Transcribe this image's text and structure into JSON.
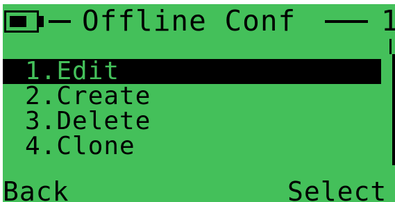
{
  "header": {
    "title": "Offline Conf",
    "corner_text": "1",
    "battery_icon": "battery-icon"
  },
  "menu": {
    "items": [
      {
        "label": "1.Edit",
        "selected": true
      },
      {
        "label": "2.Create",
        "selected": false
      },
      {
        "label": "3.Delete",
        "selected": false
      },
      {
        "label": "4.Clone",
        "selected": false
      }
    ]
  },
  "softkeys": {
    "left": "Back",
    "right": "Select"
  },
  "colors": {
    "screen_background": "#44c05a",
    "foreground": "#000000"
  }
}
